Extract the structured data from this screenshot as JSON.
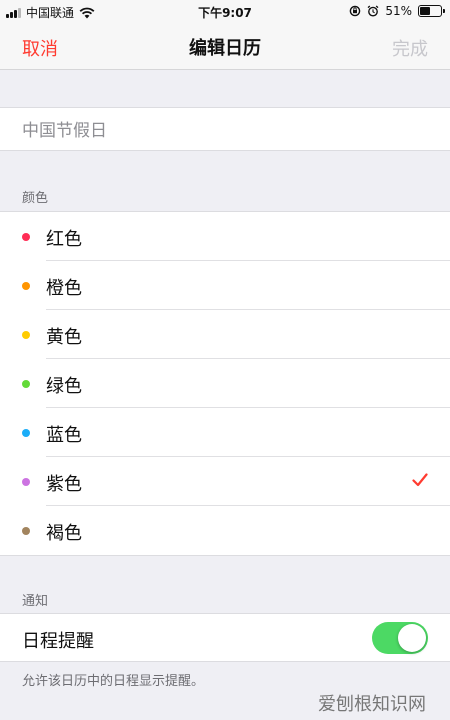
{
  "status_bar": {
    "carrier": "中国联通",
    "time": "下午9:07",
    "battery": "51%",
    "battery_level": 0.51,
    "icons": [
      "signal-icon",
      "wifi-icon",
      "rotation-lock-icon",
      "alarm-icon",
      "battery-icon"
    ]
  },
  "nav": {
    "cancel": "取消",
    "title": "编辑日历",
    "done": "完成"
  },
  "calendar_name": {
    "value": "中国节假日"
  },
  "color_section": {
    "header": "颜色",
    "items": [
      {
        "label": "红色",
        "color": "#ff2d55",
        "selected": false
      },
      {
        "label": "橙色",
        "color": "#ff9500",
        "selected": false
      },
      {
        "label": "黄色",
        "color": "#ffcc00",
        "selected": false
      },
      {
        "label": "绿色",
        "color": "#63da38",
        "selected": false
      },
      {
        "label": "蓝色",
        "color": "#1badf8",
        "selected": false
      },
      {
        "label": "紫色",
        "color": "#cc73e1",
        "selected": true
      },
      {
        "label": "褐色",
        "color": "#a2845e",
        "selected": false
      }
    ]
  },
  "notify_section": {
    "header": "通知",
    "label": "日程提醒",
    "enabled": true,
    "footer": "允许该日历中的日程显示提醒。"
  },
  "colors": {
    "accent": "#ff3b30",
    "toggle_on": "#4cd964",
    "disabled": "#c7c7cc"
  },
  "watermark": "爱刨根知识网"
}
